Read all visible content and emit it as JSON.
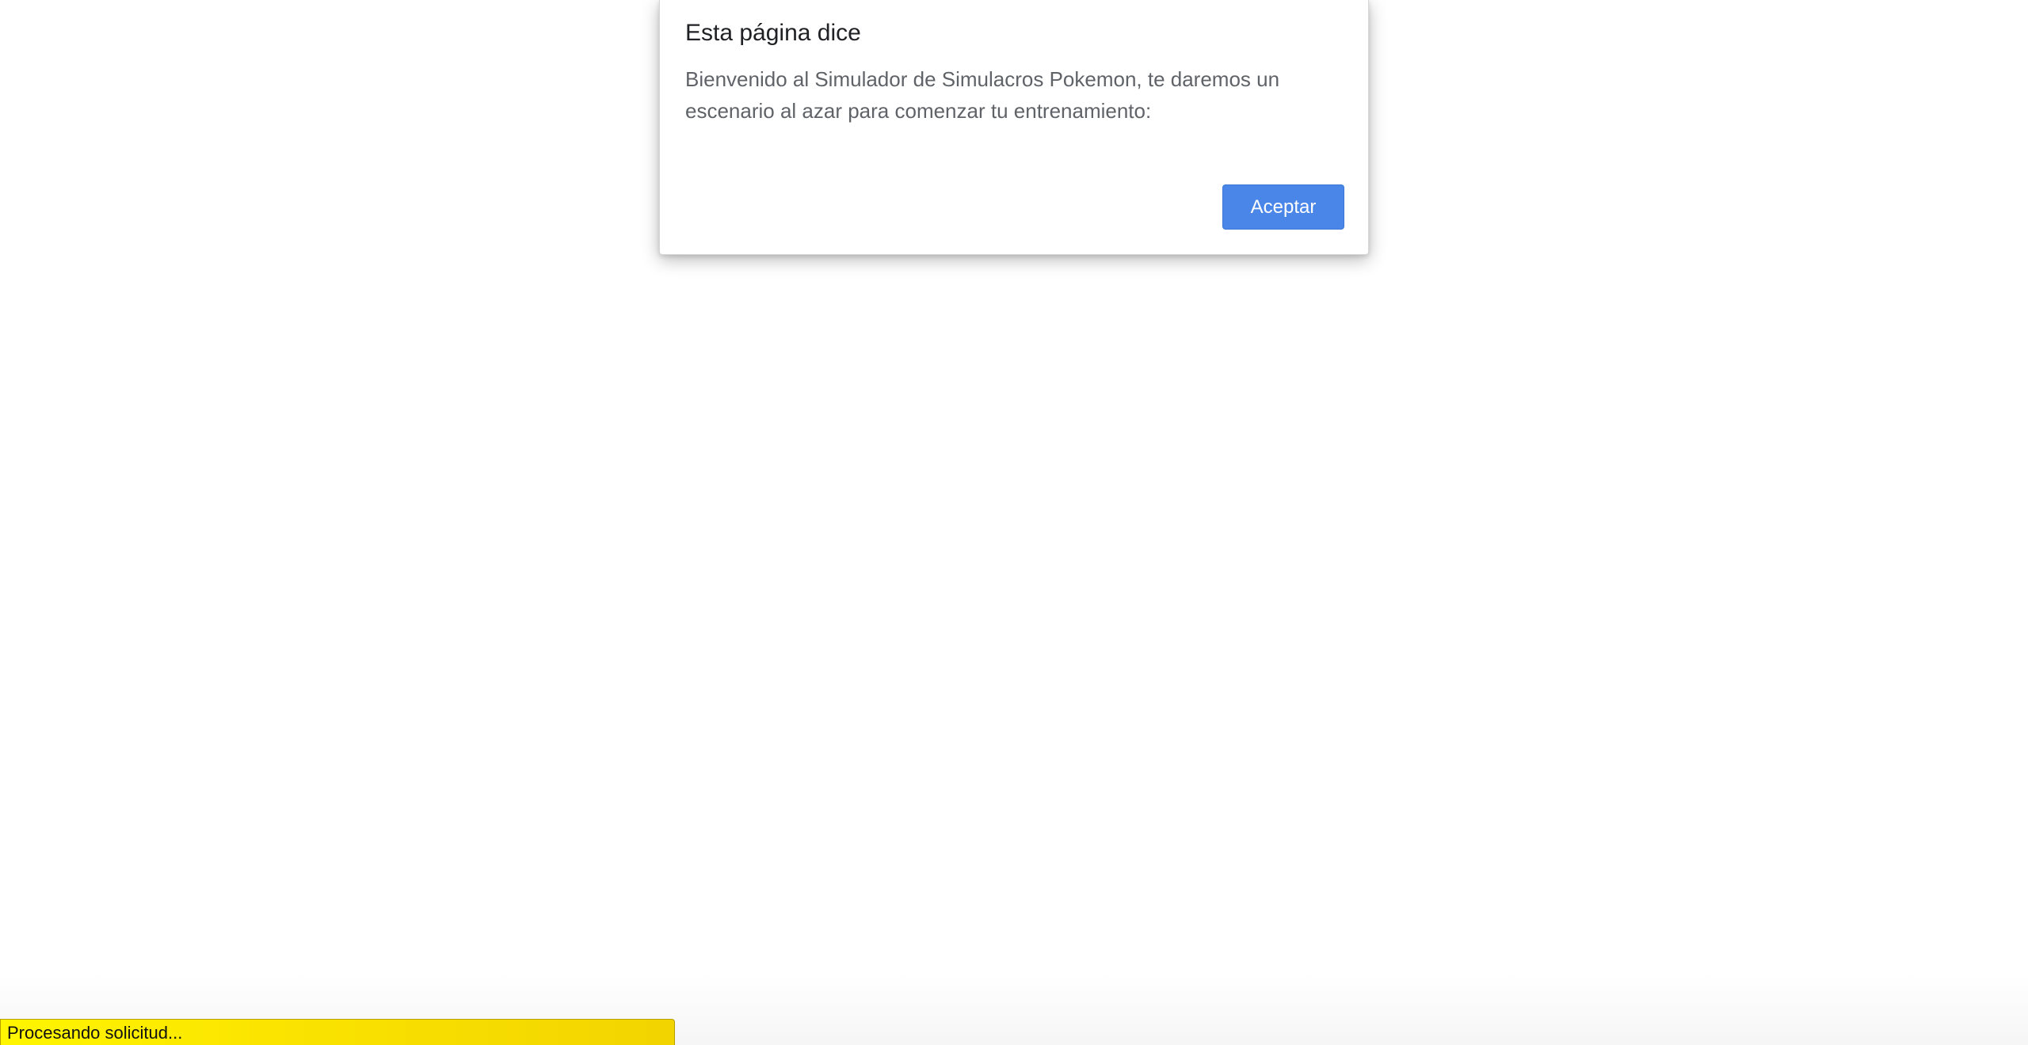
{
  "dialog": {
    "title": "Esta página dice",
    "message": "Bienvenido al Simulador de Simulacros Pokemon, te daremos un escenario al azar para comenzar tu entrenamiento:",
    "accept_label": "Aceptar"
  },
  "status_bar": {
    "text": "Procesando solicitud..."
  },
  "colors": {
    "accept_button": "#4a86e8",
    "status_bar": "#fbe400"
  }
}
